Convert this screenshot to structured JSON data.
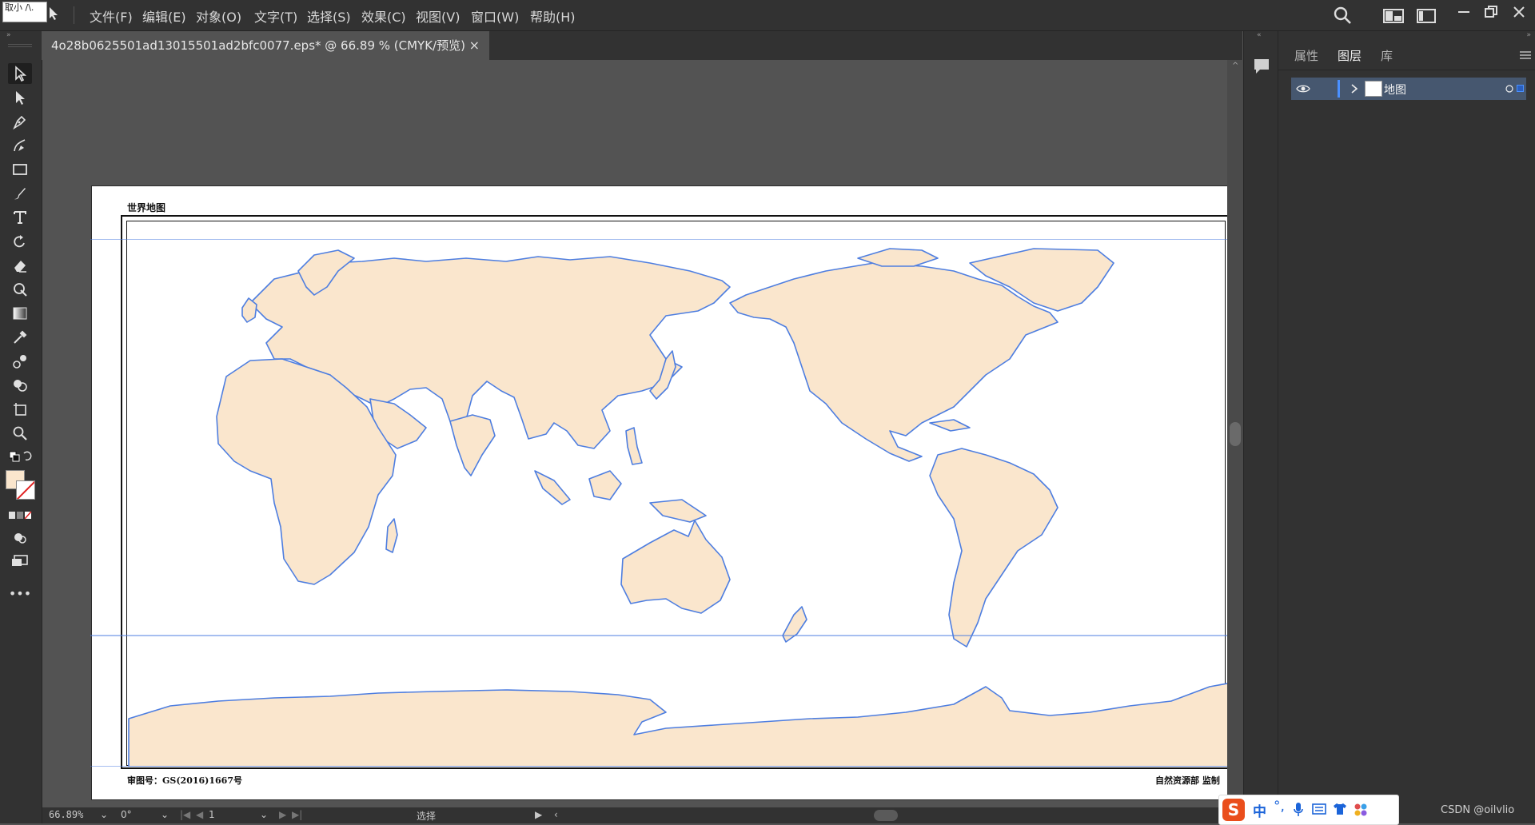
{
  "app": {
    "logo_text": "取小 /\\."
  },
  "menu": [
    {
      "label": "文件(F)"
    },
    {
      "label": "编辑(E)"
    },
    {
      "label": "对象(O)"
    },
    {
      "label": "文字(T)"
    },
    {
      "label": "选择(S)"
    },
    {
      "label": "效果(C)"
    },
    {
      "label": "视图(V)"
    },
    {
      "label": "窗口(W)"
    },
    {
      "label": "帮助(H)"
    }
  ],
  "document": {
    "tab_title": "4o28b0625501ad13015501ad2bfc0077.eps* @ 66.89 % (CMYK/预览)",
    "close_glyph": "×"
  },
  "map": {
    "title": "世界地图",
    "approval_number": "审图号：GS(2016)1667号",
    "publisher": "自然资源部  监制",
    "land_fill": "#fae6cd",
    "outline_color": "#4e7ee0"
  },
  "panel": {
    "tabs": [
      "属性",
      "图层",
      "库"
    ],
    "active_tab": "图层",
    "layers": [
      {
        "name": "地图",
        "visible": true
      }
    ]
  },
  "status": {
    "zoom": "66.89%",
    "rotation": "0°",
    "artboard": "1",
    "tool": "选择"
  },
  "ime": {
    "language": "中",
    "punctuation": "°,"
  },
  "watermark": "CSDN @oilvlio",
  "colors": {
    "fill": "#fae6cd",
    "stroke": "none"
  }
}
